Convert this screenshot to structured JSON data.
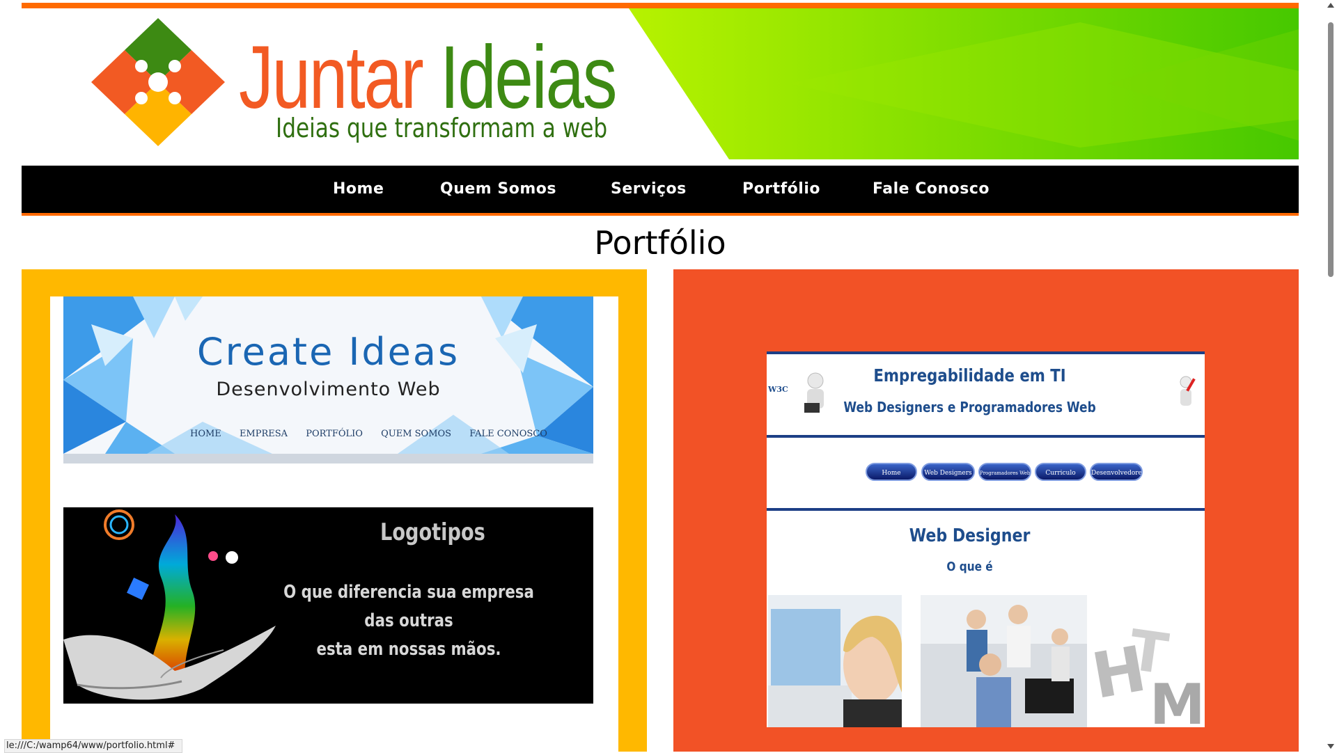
{
  "site": {
    "brand_word1": "Juntar",
    "brand_word2": "Ideias",
    "slogan": "Ideias que transformam a web",
    "accent_orange": "#ff6a00",
    "brand_green": "#3d8a13"
  },
  "nav": {
    "items": [
      {
        "label": "Home"
      },
      {
        "label": "Quem Somos"
      },
      {
        "label": "Serviços"
      },
      {
        "label": "Portfólio"
      },
      {
        "label": "Fale Conosco"
      }
    ]
  },
  "page_title": "Portfólio",
  "portfolio": {
    "create_ideas": {
      "title": "Create Ideas",
      "subtitle": "Desenvolvimento Web",
      "menu": [
        "HOME",
        "EMPRESA",
        "PORTFÓLIO",
        "QUEM SOMOS",
        "FALE CONOSCO"
      ]
    },
    "logotipos": {
      "heading": "Logotipos",
      "line1": "O que diferencia sua  empresa",
      "line2": "das outras",
      "line3": "esta em nossas mãos."
    },
    "empregabilidade": {
      "title": "Empregabilidade em TI",
      "subtitle": "Web Designers e Programadores Web",
      "buttons": [
        "Home",
        "Web Designers",
        "Programadores Web",
        "Curriculo",
        "Desenvolvedores"
      ],
      "section_title": "Web Designer",
      "section_sub": "O que é",
      "corner_logo": "W3C"
    }
  },
  "status_url": "le:///C:/wamp64/www/portfolio.html#"
}
